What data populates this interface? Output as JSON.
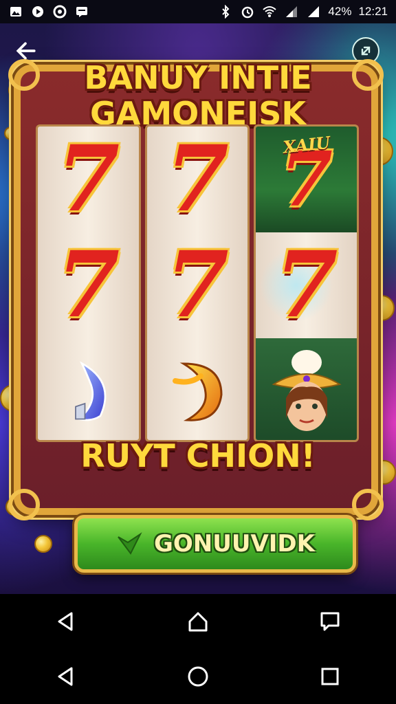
{
  "status_bar": {
    "left_icons": [
      "photo-icon",
      "play-icon",
      "circle-icon",
      "message-icon"
    ],
    "right_icons": [
      "bluetooth-icon",
      "alarm-icon",
      "wifi-icon",
      "signal-icon",
      "signal-icon"
    ],
    "battery": "42%",
    "time": "12:21"
  },
  "game": {
    "title_line1": "BANUY INTIE",
    "title_line2": "GAMONEISK",
    "result_text": "RUYT CHION!",
    "spin_button_label": "GONUUVIDK",
    "jungle_label": "XAIU",
    "reels": [
      [
        "7",
        "7",
        "crescent-blue"
      ],
      [
        "7",
        "7",
        "crescent-gold"
      ],
      [
        "7",
        "7",
        "character-face"
      ]
    ],
    "colors": {
      "title": "#ffd93c",
      "seven": "#e1231f",
      "button_green": "#49b52a",
      "frame_gold": "#e1a63a"
    }
  },
  "nav": {
    "top": [
      "back-triangle-icon",
      "home-icon",
      "recents-icon"
    ],
    "bottom": [
      "back-triangle-icon",
      "home-circle-icon",
      "square-icon"
    ]
  }
}
